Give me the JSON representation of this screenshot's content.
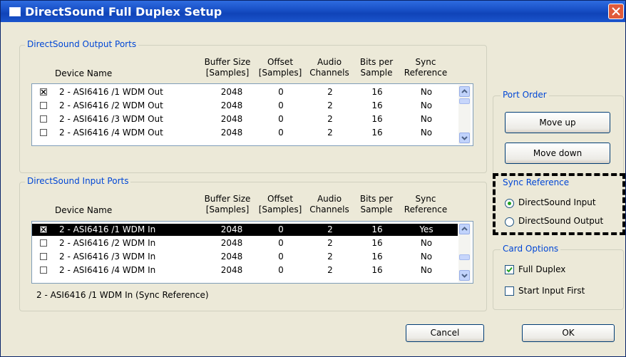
{
  "window": {
    "title": "DirectSound Full Duplex Setup"
  },
  "output_ports": {
    "label": "DirectSound Output Ports",
    "headers": {
      "device": "Device Name",
      "buffer": [
        "Buffer Size",
        "[Samples]"
      ],
      "offset": [
        "Offset",
        "[Samples]"
      ],
      "channels": [
        "Audio",
        "Channels"
      ],
      "bits": [
        "Bits per",
        "Sample"
      ],
      "sync": [
        "Sync",
        "Reference"
      ]
    },
    "rows": [
      {
        "checked": true,
        "device": "2 - ASI6416 /1 WDM Out",
        "buffer": "2048",
        "offset": "0",
        "channels": "2",
        "bits": "16",
        "sync": "No"
      },
      {
        "checked": false,
        "device": "2 - ASI6416 /2 WDM Out",
        "buffer": "2048",
        "offset": "0",
        "channels": "2",
        "bits": "16",
        "sync": "No"
      },
      {
        "checked": false,
        "device": "2 - ASI6416 /3 WDM Out",
        "buffer": "2048",
        "offset": "0",
        "channels": "2",
        "bits": "16",
        "sync": "No"
      },
      {
        "checked": false,
        "device": "2 - ASI6416 /4 WDM Out",
        "buffer": "2048",
        "offset": "0",
        "channels": "2",
        "bits": "16",
        "sync": "No"
      }
    ]
  },
  "input_ports": {
    "label": "DirectSound Input Ports",
    "headers": {
      "device": "Device Name",
      "buffer": [
        "Buffer Size",
        "[Samples]"
      ],
      "offset": [
        "Offset",
        "[Samples]"
      ],
      "channels": [
        "Audio",
        "Channels"
      ],
      "bits": [
        "Bits per",
        "Sample"
      ],
      "sync": [
        "Sync",
        "Reference"
      ]
    },
    "rows": [
      {
        "checked": true,
        "selected": true,
        "device": "2 - ASI6416 /1 WDM In",
        "buffer": "2048",
        "offset": "0",
        "channels": "2",
        "bits": "16",
        "sync": "Yes"
      },
      {
        "checked": false,
        "device": "2 - ASI6416 /2 WDM In",
        "buffer": "2048",
        "offset": "0",
        "channels": "2",
        "bits": "16",
        "sync": "No"
      },
      {
        "checked": false,
        "device": "2 - ASI6416 /3 WDM In",
        "buffer": "2048",
        "offset": "0",
        "channels": "2",
        "bits": "16",
        "sync": "No"
      },
      {
        "checked": false,
        "device": "2 - ASI6416 /4 WDM In",
        "buffer": "2048",
        "offset": "0",
        "channels": "2",
        "bits": "16",
        "sync": "No"
      }
    ],
    "status": "2 - ASI6416 /1 WDM In (Sync Reference)"
  },
  "port_order": {
    "label": "Port Order",
    "move_up": "Move up",
    "move_down": "Move down"
  },
  "sync_reference": {
    "label": "Sync Reference",
    "options": [
      "DirectSound Input",
      "DirectSound Output"
    ],
    "selected": 0
  },
  "card_options": {
    "label": "Card Options",
    "full_duplex": "Full Duplex",
    "full_duplex_checked": true,
    "start_input_first": "Start Input First",
    "start_input_first_checked": false
  },
  "buttons": {
    "cancel": "Cancel",
    "ok": "OK"
  },
  "colors": {
    "accent": "#0046d5",
    "title_bar": "#1a52c8",
    "radio_dot": "#21a121",
    "check": "#21a121"
  }
}
